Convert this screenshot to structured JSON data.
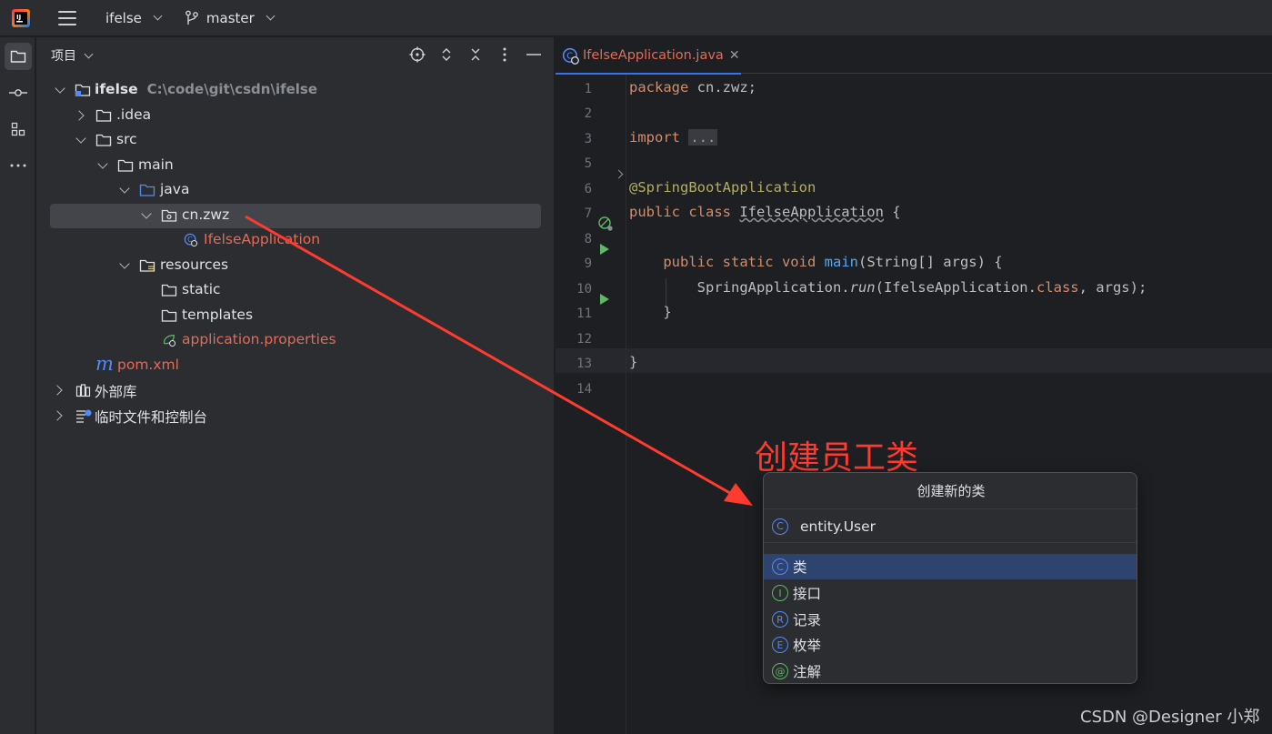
{
  "topbar": {
    "project_name": "ifelse",
    "branch_name": "master"
  },
  "project_panel": {
    "title": "项目",
    "tree": [
      {
        "label": "ifelse",
        "hint": "C:\\code\\git\\csdn\\ifelse"
      },
      {
        "label": ".idea"
      },
      {
        "label": "src"
      },
      {
        "label": "main"
      },
      {
        "label": "java"
      },
      {
        "label": "cn.zwz"
      },
      {
        "label": "IfelseApplication"
      },
      {
        "label": "resources"
      },
      {
        "label": "static"
      },
      {
        "label": "templates"
      },
      {
        "label": "application.properties"
      },
      {
        "label": "pom.xml"
      },
      {
        "label": "外部库"
      },
      {
        "label": "临时文件和控制台"
      }
    ]
  },
  "editor": {
    "tab_label": "IfelseApplication.java",
    "line_numbers": [
      "1",
      "2",
      "3",
      "5",
      "6",
      "7",
      "8",
      "9",
      "10",
      "11",
      "12",
      "13",
      "14"
    ],
    "code": {
      "l1_kw": "package",
      "l1_rest": " cn.zwz;",
      "l3_kw": "import",
      "l3_fold": "...",
      "l6_ann": "@SpringBootApplication",
      "l7_kw": "public class",
      "l7_name": "IfelseApplication",
      "l7_brace": " {",
      "l9_kw": "public static void",
      "l9_fn": "main",
      "l9_rest": "(String[] args) {",
      "l10_a": "SpringApplication.",
      "l10_run": "run",
      "l10_b": "(IfelseApplication.",
      "l10_kw": "class",
      "l10_c": ", args);",
      "l11": "}",
      "l13": "}"
    }
  },
  "annotation": {
    "title": "创建员工类",
    "watermark": "CSDN @Designer 小郑"
  },
  "popup": {
    "title": "创建新的类",
    "input_value": "entity.User",
    "options": [
      {
        "letter": "C",
        "label": "类",
        "color": "#548af7"
      },
      {
        "letter": "I",
        "label": "接口",
        "color": "#5fb865"
      },
      {
        "letter": "R",
        "label": "记录",
        "color": "#548af7"
      },
      {
        "letter": "E",
        "label": "枚举",
        "color": "#548af7"
      },
      {
        "letter": "@",
        "label": "注解",
        "color": "#5fb865"
      }
    ]
  },
  "colors": {
    "accent": "#3574f0",
    "error_red": "#e06c5a",
    "annotation_red": "#ff3b30"
  }
}
